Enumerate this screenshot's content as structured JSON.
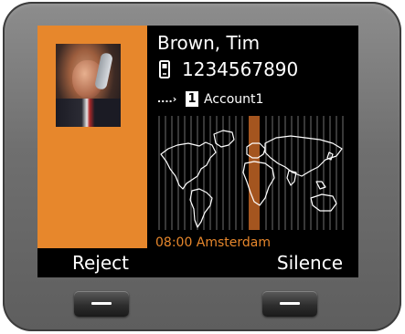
{
  "call": {
    "contact_name": "Brown, Tim",
    "phone_number": "1234567890",
    "number_type_icon": "mobile-phone-icon",
    "account_number": "1",
    "account_name": "Account1",
    "caller_photo": "caller-photo"
  },
  "world_clock": {
    "time": "08:00",
    "city": "Amsterdam",
    "label": "08:00 Amsterdam"
  },
  "softkeys": {
    "left_label": "Reject",
    "right_label": "Silence"
  },
  "colors": {
    "accent": "#e7872c",
    "screen_background": "#000000",
    "device_body": "#6f6f6f",
    "text": "#ffffff"
  }
}
